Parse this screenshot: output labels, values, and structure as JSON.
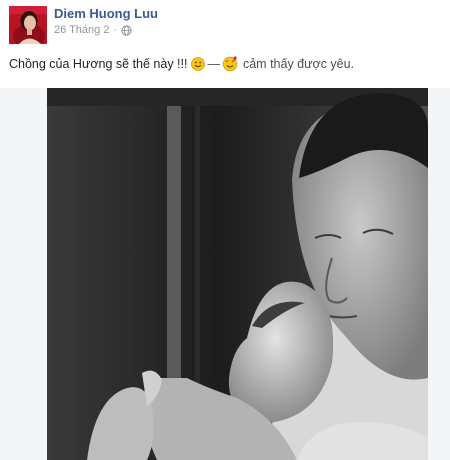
{
  "post": {
    "author": "Diem Huong Luu",
    "date": "26 Tháng 2",
    "privacy_icon": "globe-icon",
    "caption": "Chồng của Hương sẽ thế này !!!",
    "separator": "—",
    "feeling_text": "cảm thấy được yêu.",
    "emoji_1": "smiley-icon",
    "emoji_2": "in-love-icon"
  },
  "colors": {
    "author_link": "#3b5998",
    "meta_grey": "#90949c",
    "photo_frame": "#f4f5f7"
  }
}
